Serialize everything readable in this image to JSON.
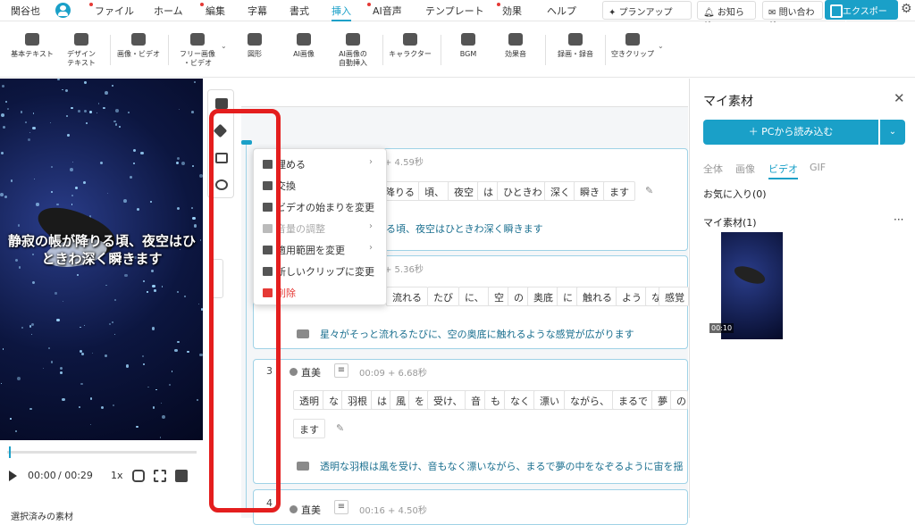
{
  "topbar": {
    "user_name": "関谷也",
    "menus": [
      {
        "label": "ファイル",
        "dot": true,
        "active": false
      },
      {
        "label": "ホーム",
        "dot": false,
        "active": false
      },
      {
        "label": "編集",
        "dot": true,
        "active": false
      },
      {
        "label": "字幕",
        "dot": false,
        "active": false
      },
      {
        "label": "書式",
        "dot": false,
        "active": false
      },
      {
        "label": "挿入",
        "dot": false,
        "active": true
      },
      {
        "label": "AI音声",
        "dot": true,
        "active": false
      },
      {
        "label": "テンプレート",
        "dot": false,
        "active": false
      },
      {
        "label": "効果",
        "dot": true,
        "active": false
      },
      {
        "label": "ヘルプ",
        "dot": false,
        "active": false
      }
    ],
    "plan_label": "プランアップ",
    "notice_label": "お知らせ",
    "contact_label": "問い合わせ",
    "export_label": "エクスポート",
    "accent_color": "#1aa0c8"
  },
  "ribbon": {
    "tools": [
      {
        "line1": "基本テキスト",
        "line2": "",
        "icon": "text-icon"
      },
      {
        "line1": "デザイン",
        "line2": "テキスト",
        "icon": "design-text-icon"
      },
      {
        "line1": "画像・ビデオ",
        "line2": "",
        "icon": "image-video-icon"
      },
      {
        "line1": "フリー画像",
        "line2": "・ビデオ",
        "icon": "free-image-icon"
      },
      {
        "line1": "図形",
        "line2": "",
        "icon": "shape-icon"
      },
      {
        "line1": "AI画像",
        "line2": "",
        "icon": "ai-image-icon"
      },
      {
        "line1": "AI画像の",
        "line2": "自動挿入",
        "icon": "ai-auto-insert-icon"
      },
      {
        "line1": "キャラクター",
        "line2": "",
        "icon": "character-icon"
      },
      {
        "line1": "BGM",
        "line2": "",
        "icon": "music-icon"
      },
      {
        "line1": "効果音",
        "line2": "",
        "icon": "sound-effect-icon"
      },
      {
        "line1": "録画・録音",
        "line2": "",
        "icon": "record-icon"
      },
      {
        "line1": "空きクリップ",
        "line2": "",
        "icon": "empty-clip-icon"
      }
    ]
  },
  "preview": {
    "caption": "静寂の帳が降りる頃、夜空はひときわ深く瞬きます",
    "time_current": "00:00",
    "time_total": "/ 00:29",
    "speed": "1x",
    "selected_label": "選択済みの素材"
  },
  "context_menu": {
    "items": [
      {
        "label": "埋める",
        "arrow": true,
        "style": "normal",
        "icon": "fill-icon"
      },
      {
        "label": "交換",
        "arrow": false,
        "style": "normal",
        "icon": "swap-icon"
      },
      {
        "label": "ビデオの始まりを変更",
        "arrow": false,
        "style": "normal",
        "icon": "bracket-icon"
      },
      {
        "label": "音量の調整",
        "arrow": true,
        "style": "disabled",
        "icon": "volume-icon"
      },
      {
        "label": "適用範囲を変更",
        "arrow": true,
        "style": "normal",
        "icon": "range-icon"
      },
      {
        "label": "新しいクリップに変更",
        "arrow": false,
        "style": "normal",
        "icon": "new-clip-icon"
      },
      {
        "label": "削除",
        "arrow": false,
        "style": "delete",
        "icon": "trash-icon"
      }
    ]
  },
  "clips": [
    {
      "number": "",
      "speaker": "",
      "time": "+ 4.59秒",
      "tokens": [
        "降りる",
        "頃、",
        "夜空",
        "は",
        "ひときわ",
        "深く",
        "瞬き",
        "ます"
      ],
      "subtitle": "る頃、夜空はひときわ深く瞬きます"
    },
    {
      "number": "",
      "speaker": "",
      "time": "+ 5.36秒",
      "tokens": [
        "流れる",
        "たび",
        "に、",
        "空",
        "の",
        "奥底",
        "に",
        "触れる",
        "よう",
        "な",
        "感覚"
      ],
      "subtitle": "星々がそっと流れるたびに、空の奥底に触れるような感覚が広がります"
    },
    {
      "number": "3",
      "speaker": "直美",
      "time": "00:09 + 6.68秒",
      "tokens": [
        "透明",
        "な",
        "羽根",
        "は",
        "風",
        "を",
        "受け、",
        "音",
        "も",
        "なく",
        "漂い",
        "ながら、",
        "まるで",
        "夢",
        "の"
      ],
      "tokens2": [
        "ます"
      ],
      "subtitle": "透明な羽根は風を受け、音もなく漂いながら、まるで夢の中をなぞるように宙を揺"
    },
    {
      "number": "4",
      "speaker": "直美",
      "time": "00:16 + 4.50秒",
      "tokens": [],
      "subtitle": ""
    }
  ],
  "assets_panel": {
    "title": "マイ素材",
    "load_button": "＋ PCから読み込む",
    "tabs": [
      {
        "label": "全体",
        "active": false
      },
      {
        "label": "画像",
        "active": false
      },
      {
        "label": "ビデオ",
        "active": true
      },
      {
        "label": "GIF",
        "active": false
      }
    ],
    "favorites_label": "お気に入り(0)",
    "my_assets_label": "マイ素材(1)",
    "thumb_duration": "00:10"
  }
}
